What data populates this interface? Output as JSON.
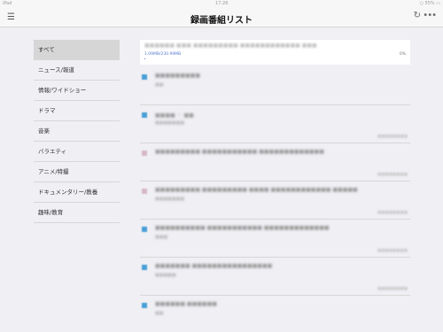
{
  "status_bar": {
    "left": "iPad",
    "center": "17:26",
    "right": "○ 55% ▭"
  },
  "nav": {
    "title": "録画番組リスト",
    "menu_icon": "☰",
    "refresh_icon": "↻",
    "more_icon": "•••"
  },
  "sidebar": {
    "items": [
      {
        "label": "すべて",
        "active": true
      },
      {
        "label": "ニュース/報道"
      },
      {
        "label": "情報/ワイドショー"
      },
      {
        "label": "ドラマ"
      },
      {
        "label": "音楽"
      },
      {
        "label": "バラエティ"
      },
      {
        "label": "アニメ/特撮"
      },
      {
        "label": "ドキュメンタリー/教養"
      },
      {
        "label": "趣味/教育"
      }
    ]
  },
  "download": {
    "title": "■■■■■■ ■■■ ■■■■■■■■■ ■■■■■■■■■■■■ ■■■",
    "size": "1.09MB/230.99MB",
    "percent": "0%",
    "progress": 0.005
  },
  "recordings": [
    {
      "title": "■■■■■■■■■",
      "sub": "■■",
      "date": "",
      "icon": "blue"
    },
    {
      "title": "■■■■ ・ ■■",
      "sub": "■■■■■■■",
      "date": "■■■■■■■■",
      "icon": "blue"
    },
    {
      "title": "■■■■■■■■■ ■■■■■■■■■■■ ■■■■■■■■■■■■■",
      "sub": "",
      "date": "■■■■■■■■",
      "icon": "grey"
    },
    {
      "title": "■■■■■■■■■ ■■■■■■■■■ ■■■■ ■■■■■■■■■■■■ ■■■■■",
      "sub": "■■■■■■■",
      "date": "■■■■■■■■",
      "icon": "grey"
    },
    {
      "title": "■■■■■■■■■■ ■■■■■■■■■■■ ■■■■■■■■■■■■■",
      "sub": "■■■",
      "date": "■■■■■■■■",
      "icon": "blue"
    },
    {
      "title": "■■■■■■■ ■■■■■■■■■■■■■■■■",
      "sub": "■■■■■",
      "date": "■■■■■■■■",
      "icon": "blue"
    },
    {
      "title": "■■■■■■ ■■■■■■",
      "sub": "■■",
      "date": "",
      "icon": "blue"
    }
  ]
}
